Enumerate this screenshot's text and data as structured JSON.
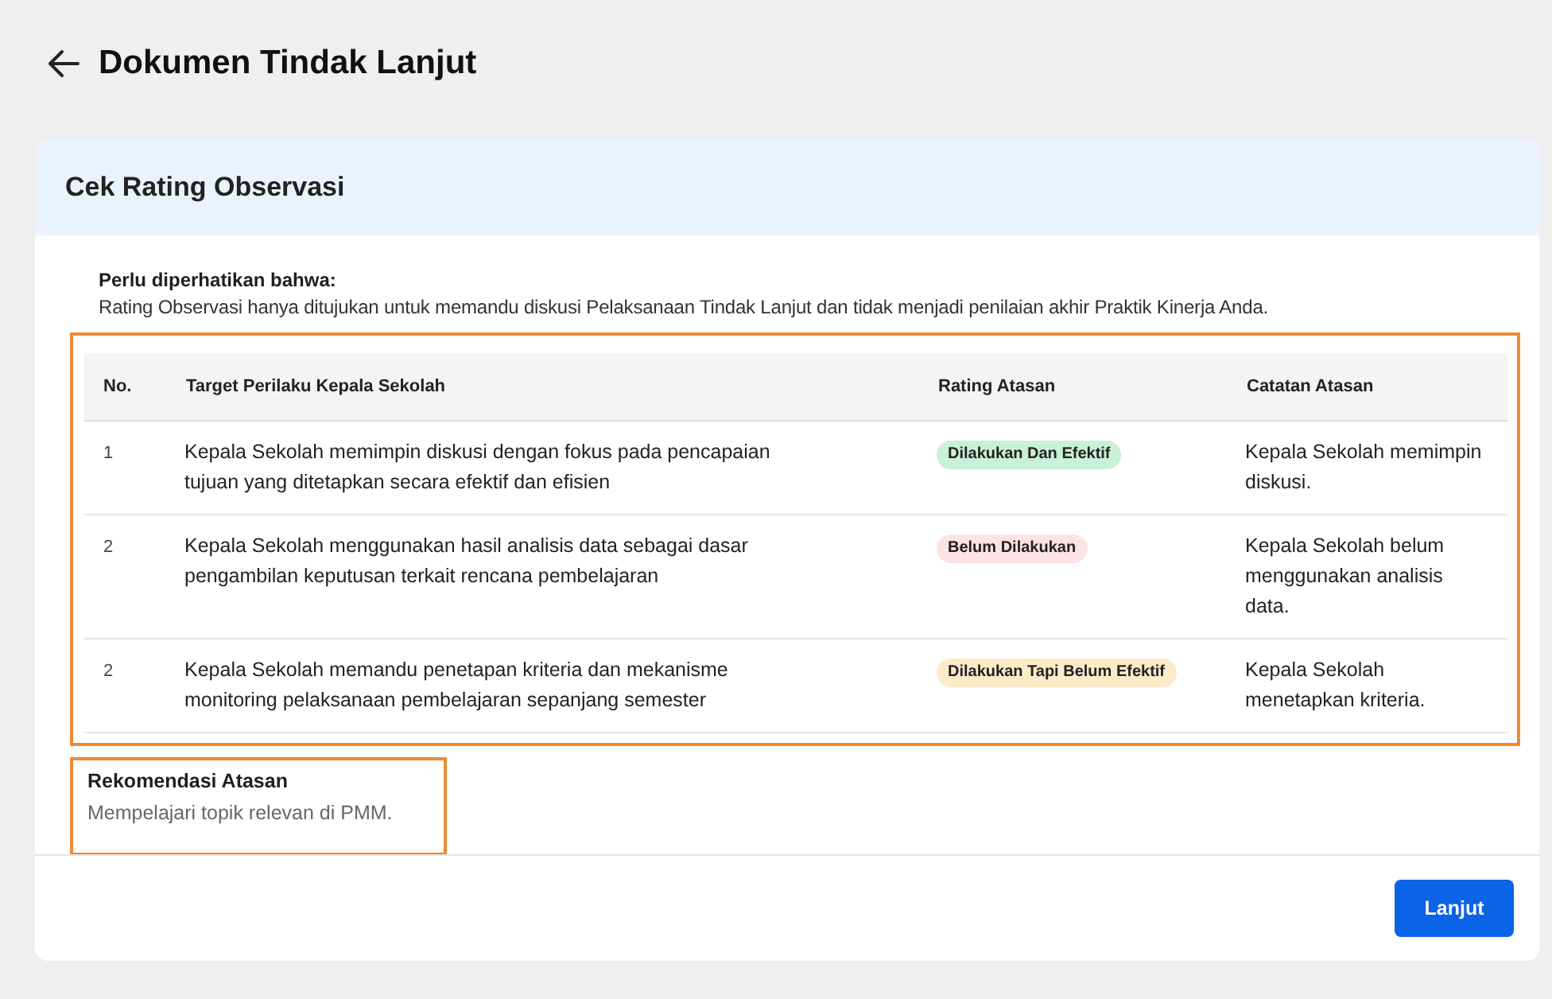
{
  "page": {
    "title": "Dokumen Tindak Lanjut"
  },
  "card": {
    "title": "Cek Rating Observasi",
    "note": {
      "heading": "Perlu diperhatikan bahwa:",
      "text": "Rating Observasi hanya ditujukan untuk memandu diskusi Pelaksanaan Tindak Lanjut dan tidak menjadi penilaian akhir Praktik Kinerja Anda."
    },
    "table": {
      "columns": [
        "No.",
        "Target Perilaku Kepala Sekolah",
        "Rating Atasan",
        "Catatan Atasan"
      ],
      "rows": [
        {
          "no": "1",
          "target": "Kepala Sekolah memimpin diskusi dengan fokus pada pencapaian tujuan yang ditetapkan secara efektif dan efisien",
          "rating": {
            "label": "Dilakukan Dan Efektif",
            "color": "#c9f0d8"
          },
          "note": "Kepala Sekolah memimpin diskusi."
        },
        {
          "no": "2",
          "target": "Kepala Sekolah menggunakan hasil analisis data sebagai dasar pengambilan keputusan terkait rencana pembelajaran",
          "rating": {
            "label": "Belum Dilakukan",
            "color": "#fde3e3"
          },
          "note": "Kepala Sekolah belum menggunakan analisis data."
        },
        {
          "no": "2",
          "target": "Kepala Sekolah memandu penetapan kriteria dan mekanisme monitoring pelaksanaan pembelajaran sepanjang semester",
          "rating": {
            "label": "Dilakukan Tapi Belum Efektif",
            "color": "#fdebc8"
          },
          "note": "Kepala Sekolah menetapkan kriteria."
        }
      ]
    },
    "recommendation": {
      "heading": "Rekomendasi Atasan",
      "text": "Mempelajari topik relevan di PMM."
    },
    "buttons": [
      "Lanjut"
    ]
  }
}
